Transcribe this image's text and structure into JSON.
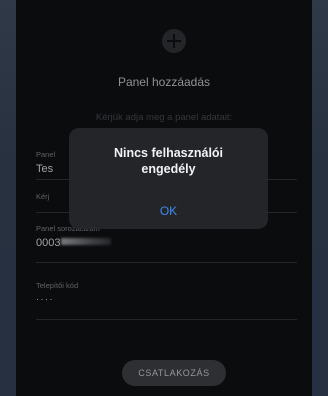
{
  "screen": {
    "title": "Panel hozzáadás",
    "subtitle": "Kérjük adja meg a panel adatait:"
  },
  "fields": [
    {
      "label": "Panel",
      "value": "Tes"
    },
    {
      "label": "Kérj",
      "value": ""
    },
    {
      "label": "Panel sorozatszám",
      "value": "0003"
    },
    {
      "label": "Telepítői kód",
      "value": "····"
    }
  ],
  "buttons": {
    "connect_label": "CSATLAKOZÁS"
  },
  "dialog": {
    "title_line1": "Nincs felhasználói",
    "title_line2": "engedély",
    "ok_label": "OK"
  },
  "colors": {
    "accent": "#3d8bf2",
    "background": "#0d0e10"
  },
  "icons": {
    "add": "plus-circle-icon"
  }
}
